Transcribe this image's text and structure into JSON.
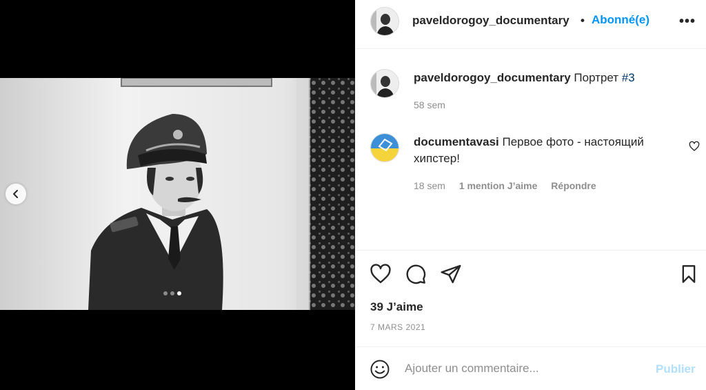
{
  "post": {
    "author": "paveldorogoy_documentary",
    "bullet": "•",
    "follow_status": "Abonné(e)",
    "more": "•••",
    "carousel": {
      "total": 3,
      "current": 3
    }
  },
  "caption": {
    "username": "paveldorogoy_documentary",
    "text": "Портрет ",
    "hashtag": "#3",
    "time": "58 sem"
  },
  "comment": {
    "username": "documentavasi",
    "text": "Первое фото - настоящий хипстер!",
    "time": "18 sem",
    "likes": "1 mention J’aime",
    "reply": "Répondre"
  },
  "stats": {
    "likes": "39 J’aime",
    "date": "7 MARS 2021"
  },
  "composer": {
    "placeholder": "Ajouter un commentaire...",
    "publish": "Publier"
  },
  "icons": {
    "prev": "chevron-left-icon",
    "like": "heart-icon",
    "comment": "comment-icon",
    "share": "send-icon",
    "save": "bookmark-icon",
    "emoji": "emoji-icon",
    "more": "more-icon"
  },
  "colors": {
    "link": "#0095f6",
    "publish_disabled": "#b2dffc",
    "hashtag": "#00376b",
    "muted": "#8e8e8e"
  }
}
